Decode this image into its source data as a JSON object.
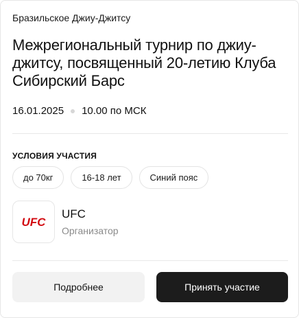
{
  "event": {
    "sport": "Бразильское Джиу-Джитсу",
    "title": "Межрегиональный турнир по джиу-джитсу, посвященный 20-летию Клуба Сибирский Барс",
    "date": "16.01.2025",
    "time": "10.00 по МСК"
  },
  "conditions": {
    "label": "УСЛОВИЯ УЧАСТИЯ",
    "chips": [
      "до 70кг",
      "16-18 лет",
      "Синий пояс"
    ]
  },
  "organizer": {
    "logo_text": "UFC",
    "logo_color": "#d20a11",
    "name": "UFC",
    "role": "Организатор"
  },
  "actions": {
    "details_label": "Подробнее",
    "join_label": "Принять участие"
  }
}
